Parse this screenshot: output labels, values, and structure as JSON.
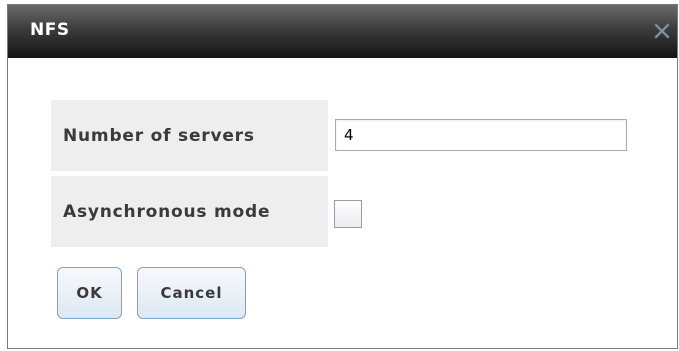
{
  "dialog": {
    "title": "NFS",
    "close_icon": "close-icon"
  },
  "form": {
    "number_of_servers": {
      "label": "Number of servers",
      "value": "4"
    },
    "asynchronous_mode": {
      "label": "Asynchronous mode",
      "checked": false
    }
  },
  "buttons": {
    "ok_label": "OK",
    "cancel_label": "Cancel"
  },
  "colors": {
    "titlebar_top": "#6a6a6a",
    "titlebar_bottom": "#141414",
    "label_background": "#eeeeee",
    "button_border": "#7aa4c8"
  }
}
